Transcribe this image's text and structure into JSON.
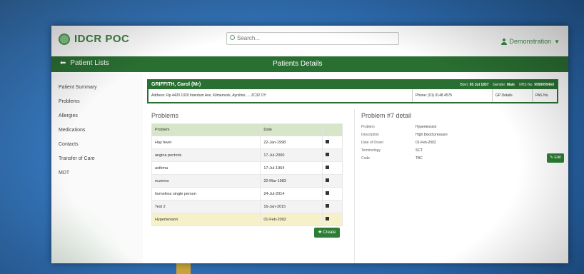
{
  "header": {
    "app_name": "IDCR POC",
    "search_placeholder": "Search...",
    "user_name": "Demonstration"
  },
  "greenbar": {
    "back_label": "Patient Lists",
    "title": "Patients Details"
  },
  "sidebar": {
    "items": [
      {
        "label": "Patient Summary"
      },
      {
        "label": "Problems"
      },
      {
        "label": "Allergies"
      },
      {
        "label": "Medications"
      },
      {
        "label": "Contacts"
      },
      {
        "label": "Transfer of Care"
      },
      {
        "label": "MDT"
      }
    ]
  },
  "patient": {
    "name": "GRIFFITH, Carol (Mr)",
    "born_label": "Born:",
    "born": "03 Jul 1937",
    "gender_label": "Gender:",
    "gender": "Male",
    "nhs_label": "NHS No.",
    "nhs": "9999999468",
    "address_label": "Address:",
    "address": "Rp 4420 1020 Interdum Ave, Kilmarnock, Ayrshire, ... ZC32 OY",
    "phone_label": "Phone:",
    "phone": "(01) 0148 4575",
    "gp_label": "GP Details",
    "pas_label": "PAS No."
  },
  "problems": {
    "title": "Problems",
    "columns": [
      "Problem",
      "Date"
    ],
    "rows": [
      {
        "problem": "Hay fever",
        "date": "22-Jan-1998"
      },
      {
        "problem": "angina pectoris",
        "date": "17-Jul-2000"
      },
      {
        "problem": "asthma",
        "date": "17-Jul-1964"
      },
      {
        "problem": "eczema",
        "date": "22-Mar-1983"
      },
      {
        "problem": "homeless single person",
        "date": "24-Jul-2014"
      },
      {
        "problem": "Test 2",
        "date": "16-Jan-2015"
      },
      {
        "problem": "Hypertension",
        "date": "01-Feb-2002"
      }
    ],
    "create_label": "✚ Create"
  },
  "detail": {
    "title": "Problem #7 detail",
    "fields": [
      {
        "key": "Problem",
        "value": "Hypertension"
      },
      {
        "key": "Description",
        "value": "High blood pressure"
      },
      {
        "key": "Date of Onset",
        "value": "01-Feb-2002"
      },
      {
        "key": "Terminology",
        "value": "SCT"
      },
      {
        "key": "Code",
        "value": "TBC"
      }
    ],
    "edit_label": "✎ Edit"
  }
}
